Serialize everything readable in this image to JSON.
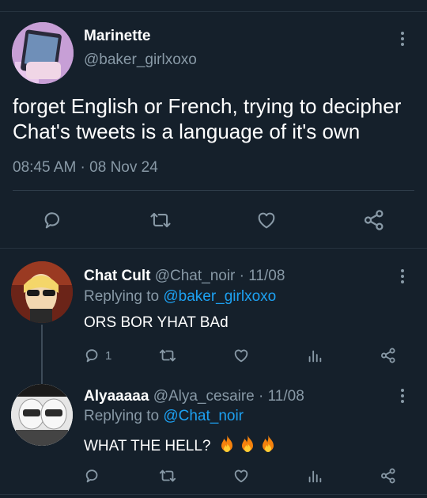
{
  "main_tweet": {
    "display_name": "Marinette",
    "handle": "@baker_girlxoxo",
    "text": "forget English or French, trying to decipher Chat's tweets is a language of it's own",
    "timestamp": "08:45 AM · 08 Nov 24"
  },
  "replies": [
    {
      "display_name": "Chat Cult",
      "handle": "@Chat_noir",
      "date": "· 11/08",
      "replying_prefix": "Replying to ",
      "replying_to": "@baker_girlxoxo",
      "text": "ORS BOR YHAT BAd",
      "reply_count": "1"
    },
    {
      "display_name": "Alyaaaaa",
      "handle": "@Alya_cesaire",
      "date": "· 11/08",
      "replying_prefix": "Replying to ",
      "replying_to": "@Chat_noir",
      "text": "WHAT THE HELL?",
      "reply_count": ""
    }
  ],
  "colors": {
    "background": "#15202b",
    "secondary_text": "#8899a6",
    "link": "#1da1f2"
  }
}
